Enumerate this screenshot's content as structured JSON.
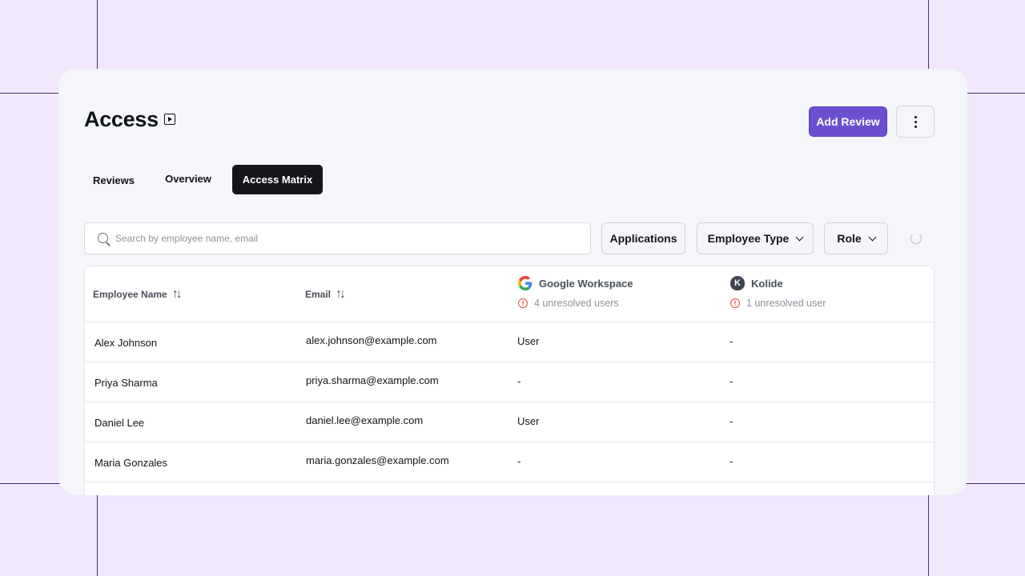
{
  "page": {
    "title": "Access",
    "title_icon": "play-square-icon"
  },
  "actions": {
    "add_review_label": "Add Review",
    "more_icon": "vertical-dots-icon",
    "accent_color": "#6b4fcf"
  },
  "tabs": [
    {
      "label": "Reviews",
      "active": false
    },
    {
      "label": "Overview",
      "active": false
    },
    {
      "label": "Access Matrix",
      "active": true
    }
  ],
  "search": {
    "placeholder": "Search by employee name, email",
    "value": ""
  },
  "filters": {
    "applications_label": "Applications",
    "employee_type_label": "Employee Type",
    "role_label": "Role"
  },
  "table": {
    "columns": {
      "employee_name": "Employee Name",
      "email": "Email"
    },
    "apps": [
      {
        "name": "Google Workspace",
        "warning": "4 unresolved users",
        "icon": "google-logo-icon"
      },
      {
        "name": "Kolide",
        "warning": "1 unresolved user",
        "icon": "kolide-logo-icon"
      }
    ],
    "rows": [
      {
        "name": "Alex Johnson",
        "email": "alex.johnson@example.com",
        "google": "User",
        "kolide": "-"
      },
      {
        "name": "Priya Sharma",
        "email": "priya.sharma@example.com",
        "google": "-",
        "kolide": "-"
      },
      {
        "name": "Daniel Lee",
        "email": "daniel.lee@example.com",
        "google": "User",
        "kolide": "-"
      },
      {
        "name": "Maria Gonzales",
        "email": "maria.gonzales@example.com",
        "google": "-",
        "kolide": "-"
      }
    ]
  }
}
